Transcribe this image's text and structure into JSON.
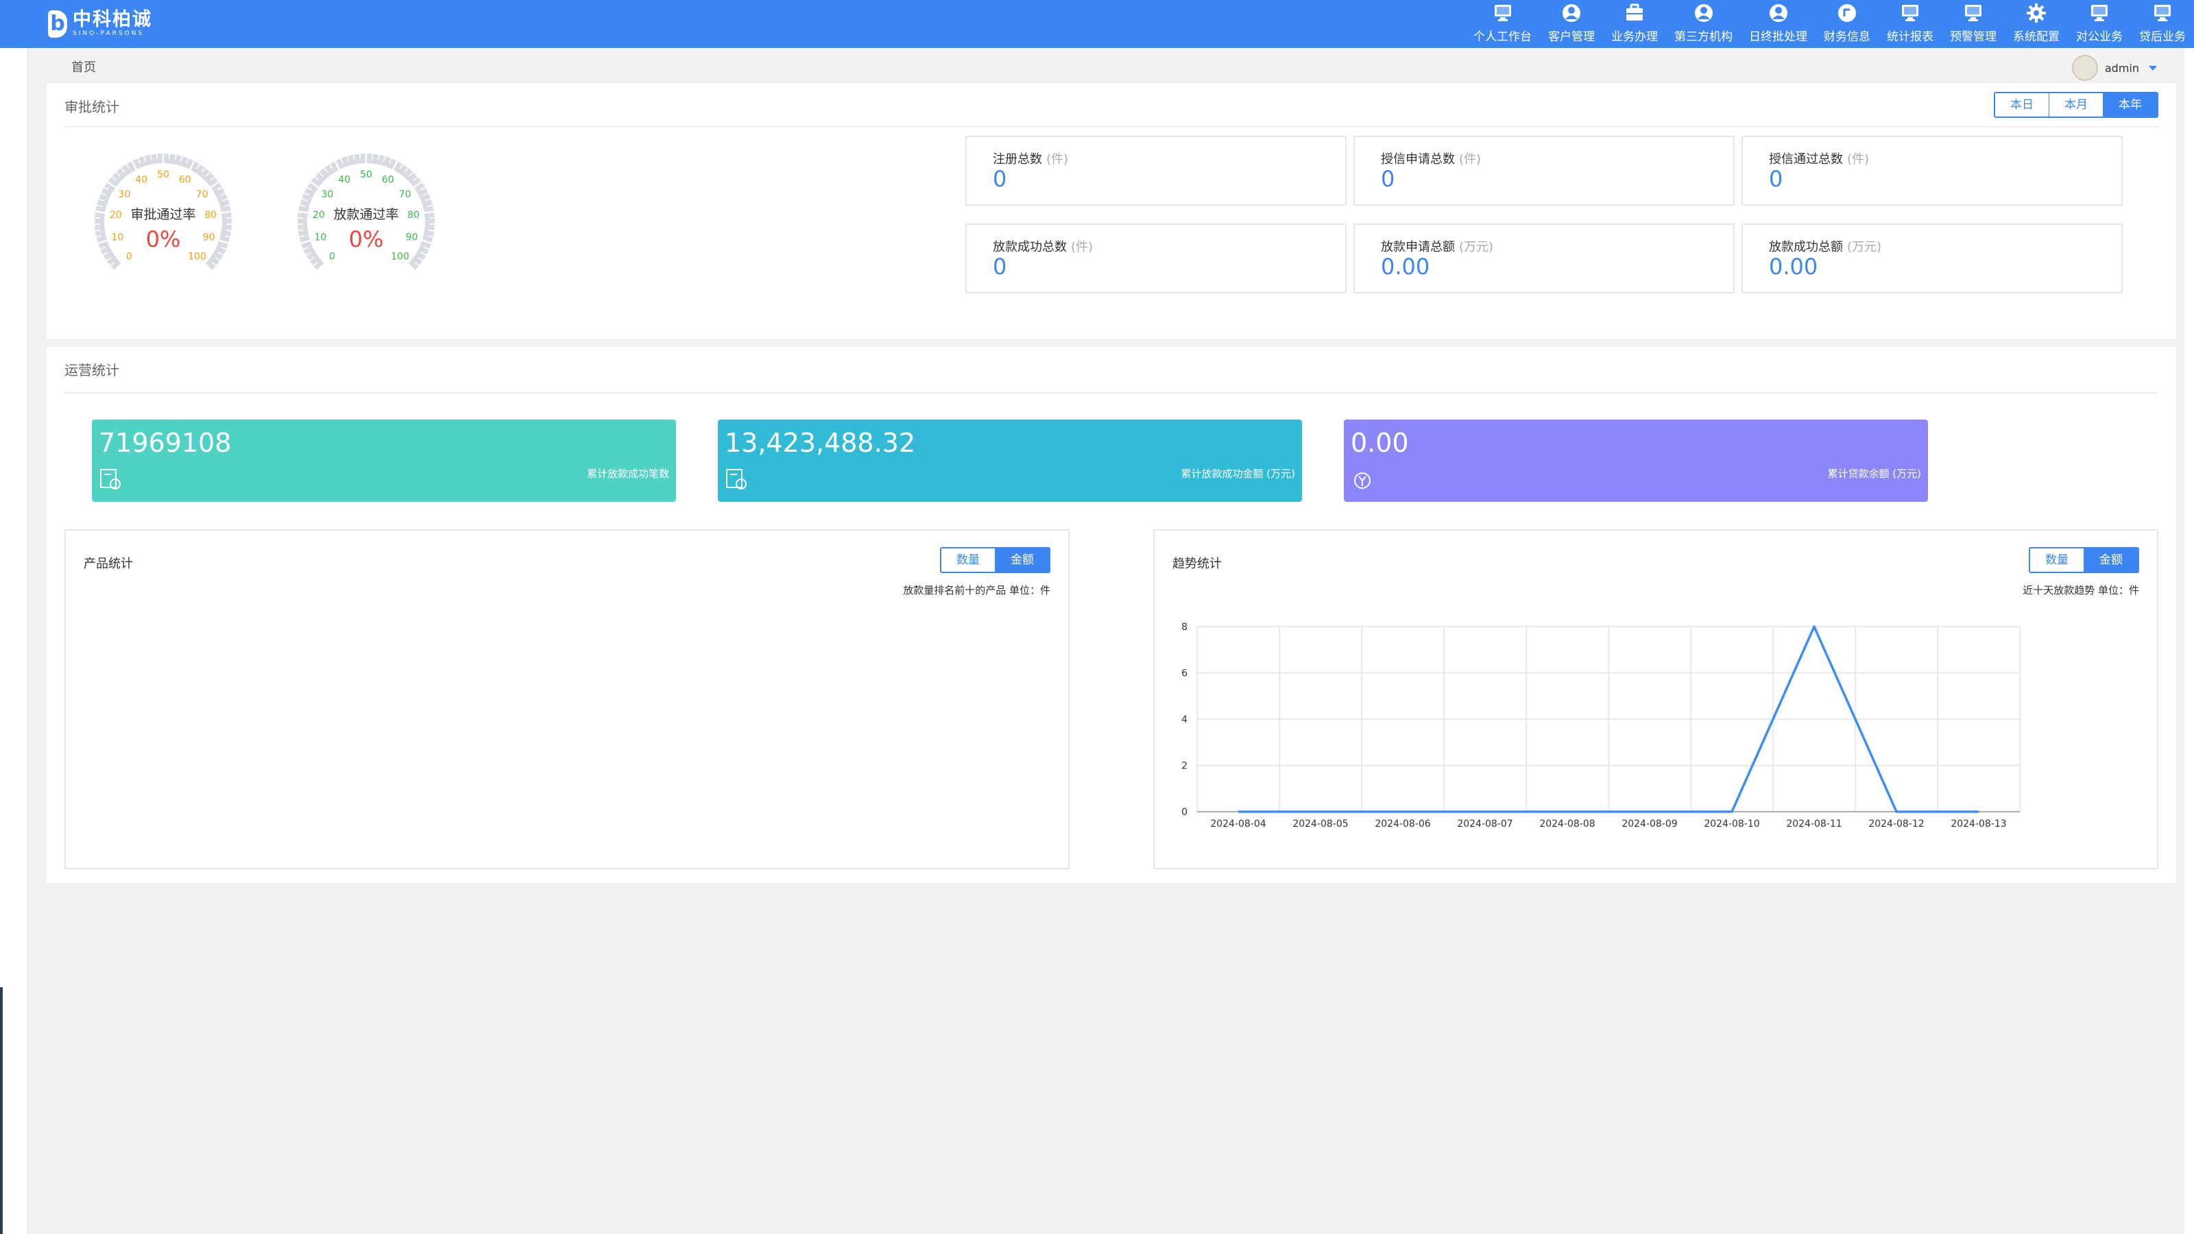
{
  "brand": {
    "name_cn": "中科柏诚",
    "name_en": "SINO-PARSONS",
    "mark": "b"
  },
  "nav": [
    {
      "label": "个人工作台",
      "icon": "monitor-icon"
    },
    {
      "label": "客户管理",
      "icon": "user-icon"
    },
    {
      "label": "业务办理",
      "icon": "briefcase-icon"
    },
    {
      "label": "第三方机构",
      "icon": "user-icon"
    },
    {
      "label": "日终批处理",
      "icon": "user-icon"
    },
    {
      "label": "财务信息",
      "icon": "coin-icon"
    },
    {
      "label": "统计报表",
      "icon": "monitor-icon"
    },
    {
      "label": "预警管理",
      "icon": "monitor-icon"
    },
    {
      "label": "系统配置",
      "icon": "gear-icon"
    },
    {
      "label": "对公业务",
      "icon": "monitor-icon"
    },
    {
      "label": "贷后业务",
      "icon": "monitor-icon"
    }
  ],
  "breadcrumb": "首页",
  "user": {
    "name": "admin"
  },
  "approval": {
    "title": "审批统计",
    "range_tabs": [
      "本日",
      "本月",
      "本年"
    ],
    "active_tab": 2,
    "gauges": [
      {
        "title": "审批通过率",
        "value": "0%",
        "percent": 0
      },
      {
        "title": "放款通过率",
        "value": "0%",
        "percent": 0
      }
    ],
    "gauge_ticks": [
      "0",
      "10",
      "20",
      "30",
      "40",
      "50",
      "60",
      "70",
      "80",
      "90",
      "100"
    ],
    "stats": [
      {
        "label": "注册总数",
        "unit": "(件)",
        "value": "0"
      },
      {
        "label": "授信申请总数",
        "unit": "(件)",
        "value": "0"
      },
      {
        "label": "授信通过总数",
        "unit": "(件)",
        "value": "0"
      },
      {
        "label": "放款成功总数",
        "unit": "(件)",
        "value": "0"
      },
      {
        "label": "放款申请总额",
        "unit": "(万元)",
        "value": "0.00"
      },
      {
        "label": "放款成功总额",
        "unit": "(万元)",
        "value": "0.00"
      }
    ]
  },
  "operations": {
    "title": "运营统计",
    "cards": [
      {
        "value": "71969108",
        "label": "累计放款成功笔数",
        "color": "#4fd2c4"
      },
      {
        "value": "13,423,488.32",
        "label": "累计放款成功金额 (万元)",
        "color": "#31bbd6"
      },
      {
        "value": "0.00",
        "label": "累计贷款余额 (万元)",
        "color": "#8c86fb"
      }
    ]
  },
  "product": {
    "title": "产品统计",
    "toggle": [
      "数量",
      "金额"
    ],
    "active_toggle": 1,
    "subtitle": "放款量排名前十的产品 单位：件"
  },
  "trend": {
    "title": "趋势统计",
    "toggle": [
      "数量",
      "金额"
    ],
    "active_toggle": 1,
    "subtitle": "近十天放款趋势 单位：件"
  },
  "chart_data": {
    "type": "line",
    "categories": [
      "2024-08-04",
      "2024-08-05",
      "2024-08-06",
      "2024-08-07",
      "2024-08-08",
      "2024-08-09",
      "2024-08-10",
      "2024-08-11",
      "2024-08-12",
      "2024-08-13"
    ],
    "values": [
      0,
      0,
      0,
      0,
      0,
      0,
      0,
      8,
      0,
      0
    ],
    "yticks": [
      0,
      2,
      4,
      6,
      8
    ],
    "ylim": [
      0,
      8
    ],
    "grid": true,
    "color": "#3c8ef5"
  }
}
